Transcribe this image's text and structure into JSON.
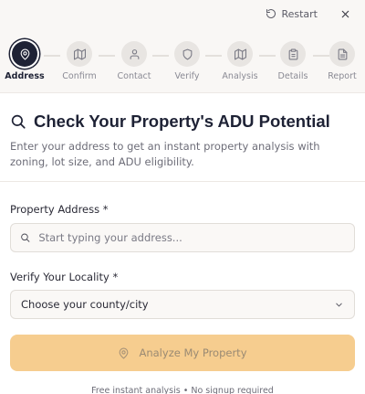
{
  "header": {
    "restart_label": "Restart"
  },
  "steps": [
    {
      "label": "Address",
      "icon": "map-pin-icon",
      "active": true
    },
    {
      "label": "Confirm",
      "icon": "map-icon",
      "active": false
    },
    {
      "label": "Contact",
      "icon": "user-icon",
      "active": false
    },
    {
      "label": "Verify",
      "icon": "shield-icon",
      "active": false
    },
    {
      "label": "Analysis",
      "icon": "map-icon",
      "active": false
    },
    {
      "label": "Details",
      "icon": "clipboard-icon",
      "active": false
    },
    {
      "label": "Report",
      "icon": "file-text-icon",
      "active": false
    }
  ],
  "main": {
    "title": "Check Your Property's ADU Potential",
    "subtitle": "Enter your address to get an instant property analysis with zoning, lot size, and ADU eligibility."
  },
  "form": {
    "address_label": "Property Address *",
    "address_placeholder": "Start typing your address...",
    "address_value": "",
    "locality_label": "Verify Your Locality *",
    "locality_selected": "Choose your county/city",
    "submit_label": "Analyze My Property",
    "footnote": "Free instant analysis • No signup required"
  },
  "colors": {
    "accent_dark": "#1e2235",
    "button_bg": "#f6cd8f",
    "page_bg": "#f9f7f5"
  }
}
